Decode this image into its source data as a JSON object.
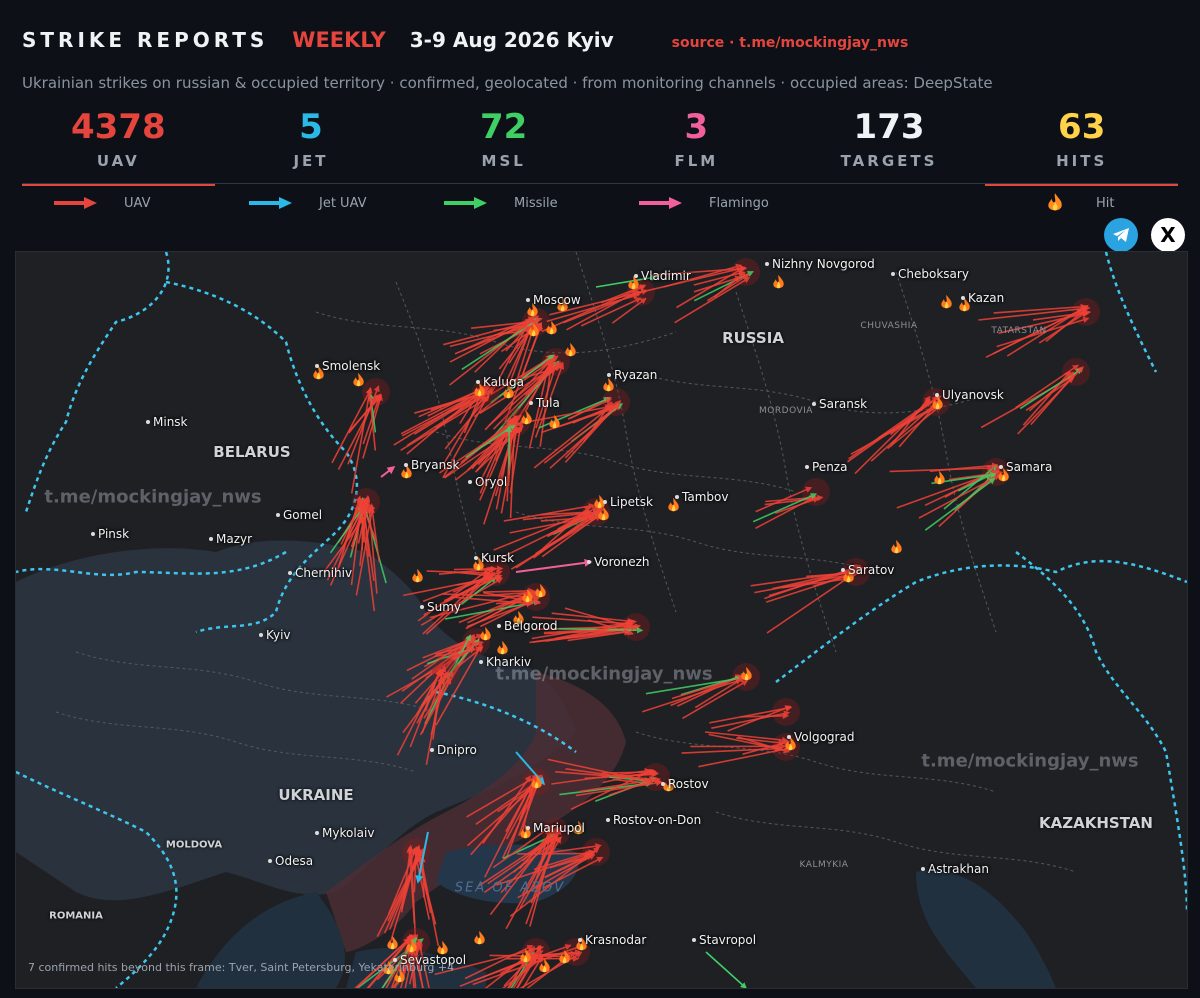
{
  "header": {
    "title": "STRIKE REPORTS",
    "period": "WEEKLY",
    "dates": "3-9 Aug 2026 Kyiv",
    "source": "source · t.me/mockingjay_nws",
    "subtitle": "Ukrainian strikes on russian & occupied territory  ·  confirmed, geolocated  ·  from monitoring channels  ·  occupied areas: DeepState"
  },
  "stats": [
    {
      "value": "4378",
      "label": "UAV",
      "color": "#e5453d"
    },
    {
      "value": "5",
      "label": "JET",
      "color": "#2bb8e6"
    },
    {
      "value": "72",
      "label": "MSL",
      "color": "#3fcf65"
    },
    {
      "value": "3",
      "label": "FLM",
      "color": "#f2609b"
    },
    {
      "value": "173",
      "label": "TARGETS",
      "color": "#f0f3f6"
    },
    {
      "value": "63",
      "label": "HITS",
      "color": "#ffd24a"
    }
  ],
  "legend": [
    {
      "label": "UAV",
      "color": "#e5453d",
      "icon": "arrow-right-icon"
    },
    {
      "label": "Jet UAV",
      "color": "#2bb8e6",
      "icon": "arrow-right-icon"
    },
    {
      "label": "Missile",
      "color": "#3fcf65",
      "icon": "arrow-right-icon"
    },
    {
      "label": "Flamingo",
      "color": "#f2609b",
      "icon": "arrow-right-icon"
    },
    {
      "label": "Hit",
      "color": "#ff8a1e",
      "icon": "fire-icon"
    }
  ],
  "map": {
    "countries": [
      "RUSSIA",
      "BELARUS",
      "UKRAINE",
      "KAZAKHSTAN",
      "MOLDOVA",
      "ROMANIA"
    ],
    "regions": [
      "CHUVASHIA",
      "TATARSTAN",
      "MORDOVIA",
      "KALMYKIA"
    ],
    "sea": "SEA OF AZOV",
    "cities": [
      "Vladimir",
      "Nizhny Novgorod",
      "Cheboksary",
      "Moscow",
      "Kazan",
      "Smolensk",
      "Ryazan",
      "Kaluga",
      "Tula",
      "Saransk",
      "Ulyanovsk",
      "Minsk",
      "Bryansk",
      "Oryol",
      "Penza",
      "Samara",
      "Lipetsk",
      "Tambov",
      "Gomel",
      "Pinsk",
      "Mazyr",
      "Kursk",
      "Voronezh",
      "Saratov",
      "Chernihiv",
      "Sumy",
      "Belgorod",
      "Kyiv",
      "Kharkiv",
      "Volgograd",
      "Dnipro",
      "Rostov",
      "Mariupol",
      "Rostov-on-Don",
      "Mykolaiv",
      "Odesa",
      "Astrakhan",
      "Krasnodar",
      "Stavropol",
      "Sevastopol"
    ],
    "watermark": "t.me/mockingjay_nws",
    "footer_note": "7 confirmed hits beyond this frame: Tver, Saint Petersburg, Yekaterinburg +4"
  },
  "buttons": {
    "telegram": "telegram-icon",
    "close": "X"
  }
}
